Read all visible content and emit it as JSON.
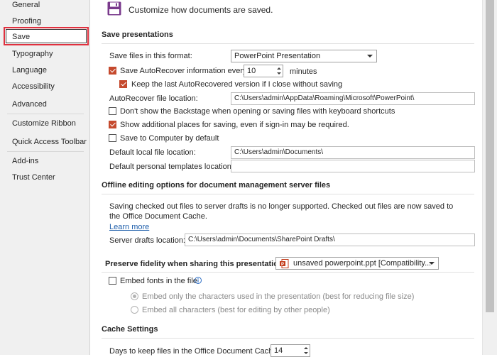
{
  "nav": {
    "items": [
      {
        "label": "General"
      },
      {
        "label": "Proofing"
      },
      {
        "label": "Save"
      },
      {
        "label": "Typography"
      },
      {
        "label": "Language"
      },
      {
        "label": "Accessibility"
      },
      {
        "label": "Advanced"
      },
      {
        "label": "Customize Ribbon"
      },
      {
        "label": "Quick Access Toolbar"
      },
      {
        "label": "Add-ins"
      },
      {
        "label": "Trust Center"
      }
    ],
    "selected": "Save",
    "accent_color": "#e0303e"
  },
  "header": {
    "icon": "floppy-disk-icon",
    "text": "Customize how documents are saved."
  },
  "save_presentations": {
    "title": "Save presentations",
    "format_label": "Save files in this format:",
    "format_value": "PowerPoint Presentation",
    "autorecover_label": "Save AutoRecover information every",
    "autorecover_checked": true,
    "autorecover_minutes": "10",
    "minutes_label": "minutes",
    "keep_last_label": "Keep the last AutoRecovered version if I close without saving",
    "keep_last_checked": true,
    "autorecover_location_label": "AutoRecover file location:",
    "autorecover_location_value": "C:\\Users\\admin\\AppData\\Roaming\\Microsoft\\PowerPoint\\",
    "backstage_label": "Don't show the Backstage when opening or saving files with keyboard shortcuts",
    "backstage_checked": false,
    "additional_places_label": "Show additional places for saving, even if sign-in may be required.",
    "additional_places_checked": true,
    "save_to_computer_label": "Save to Computer by default",
    "save_to_computer_checked": false,
    "default_local_label": "Default local file location:",
    "default_local_value": "C:\\Users\\admin\\Documents\\",
    "default_templates_label": "Default personal templates location:",
    "default_templates_value": ""
  },
  "offline": {
    "title": "Offline editing options for document management server files",
    "description": "Saving checked out files to server drafts is no longer supported. Checked out files are now saved to the Office Document Cache.",
    "learn_more": "Learn more",
    "server_drafts_label": "Server drafts location:",
    "server_drafts_value": "C:\\Users\\admin\\Documents\\SharePoint Drafts\\"
  },
  "fidelity": {
    "title": "Preserve fidelity when sharing this presentation:",
    "file_value": "unsaved powerpoint.ppt [Compatibility...",
    "file_icon": "powerpoint-file-icon",
    "embed_fonts_label": "Embed fonts in the file",
    "embed_fonts_checked": false,
    "embed_only_label": "Embed only the characters used in the presentation (best for reducing file size)",
    "embed_all_label": "Embed all characters (best for editing by other people)",
    "embed_mode": "only"
  },
  "cache": {
    "title": "Cache Settings",
    "days_label": "Days to keep files in the Office Document Cache:",
    "days_value": "14"
  },
  "colors": {
    "checkbox_checked": "#c54a2e",
    "link": "#1f5fab",
    "floppy": "#7a3a8c"
  }
}
